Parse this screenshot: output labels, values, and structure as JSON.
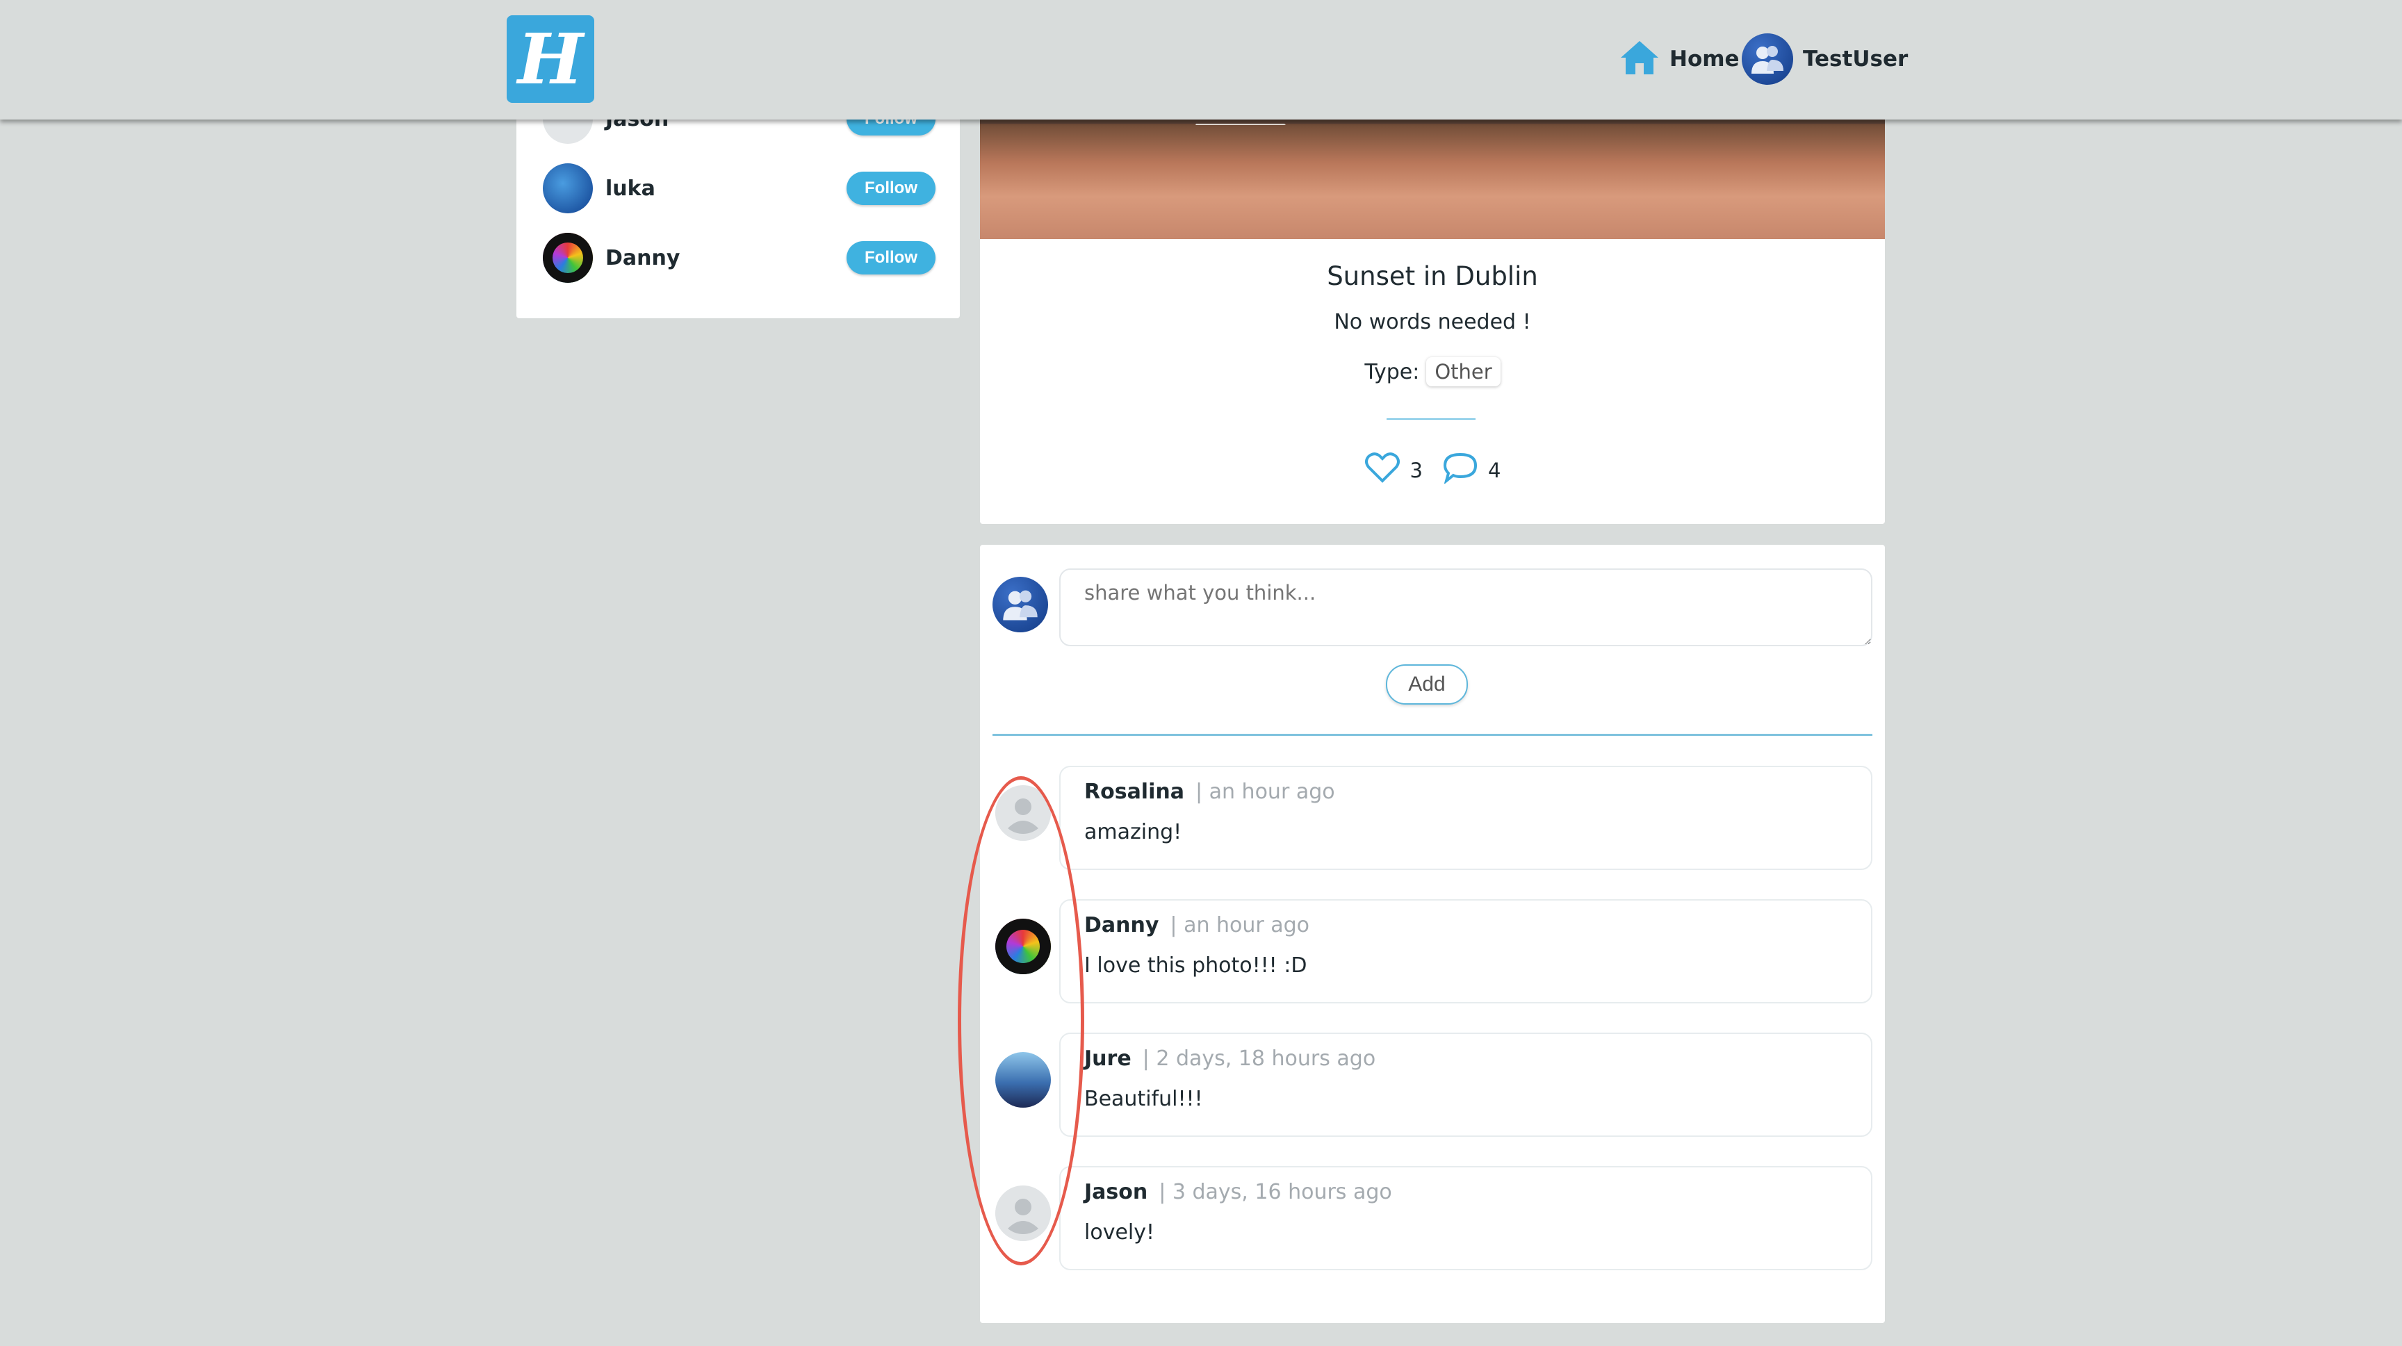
{
  "nav": {
    "logo_text": "H",
    "home_label": "Home",
    "user_label": "TestUser"
  },
  "sidebar": {
    "items": [
      {
        "name": "Jason",
        "button": "Follow"
      },
      {
        "name": "luka",
        "button": "Follow"
      },
      {
        "name": "Danny",
        "button": "Follow"
      }
    ]
  },
  "post": {
    "title": "Sunset in Dublin",
    "description": "No words needed !",
    "type_label": "Type:",
    "type_value": "Other",
    "likes": "3",
    "comments": "4"
  },
  "composer": {
    "placeholder": "share what you think...",
    "add_label": "Add"
  },
  "comments": [
    {
      "author": "Rosalina",
      "time": "| an hour ago",
      "text": "amazing!"
    },
    {
      "author": "Danny",
      "time": "| an hour ago",
      "text": "I love this photo!!! :D"
    },
    {
      "author": "Jure",
      "time": "| 2 days, 18 hours ago",
      "text": "Beautiful!!!"
    },
    {
      "author": "Jason",
      "time": "| 3 days, 16 hours ago",
      "text": "lovely!"
    }
  ],
  "colors": {
    "accent": "#3fb2e0",
    "background": "#d8dcdb",
    "highlight": "#e65a4c"
  }
}
